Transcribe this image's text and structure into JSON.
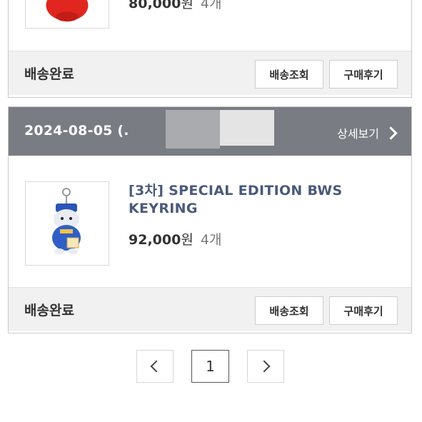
{
  "orders": [
    {
      "item": {
        "price": "80,000",
        "currency": "원",
        "quantity": "4개"
      },
      "status": "배송완료",
      "buttons": {
        "track": "배송조회",
        "review": "구매후기"
      }
    },
    {
      "date": "2024-08-05 (.",
      "detail_link": "상세보기",
      "item": {
        "name": "[3차] SPECIAL EDITION BWS KEYRING",
        "price": "92,000",
        "currency": "원",
        "quantity": "4개"
      },
      "status": "배송완료",
      "buttons": {
        "track": "배송조회",
        "review": "구매후기"
      }
    }
  ],
  "pagination": {
    "current_page": "1"
  },
  "icons": {
    "prev": "chevron-left-icon",
    "next": "chevron-right-icon",
    "detail": "chevron-right-icon"
  }
}
